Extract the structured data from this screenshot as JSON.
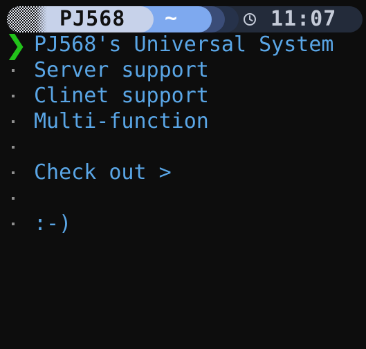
{
  "statusbar": {
    "user": "PJ568",
    "directory": "~",
    "clock_icon": "clock-icon",
    "time": "11:07"
  },
  "prompt": {
    "arrow": "❯",
    "title": "PJ568's Universal System"
  },
  "lines": [
    "Server support",
    "Clinet support",
    "Multi-function",
    "",
    "Check out >",
    "",
    ":-)"
  ],
  "colors": {
    "background": "#0d0d0d",
    "text": "#5aa6e6",
    "prompt_arrow": "#22c21a",
    "user_segment": "#c7d2ea",
    "dir_segment": "#7ea9ef",
    "time_segment": "#232b3a"
  }
}
